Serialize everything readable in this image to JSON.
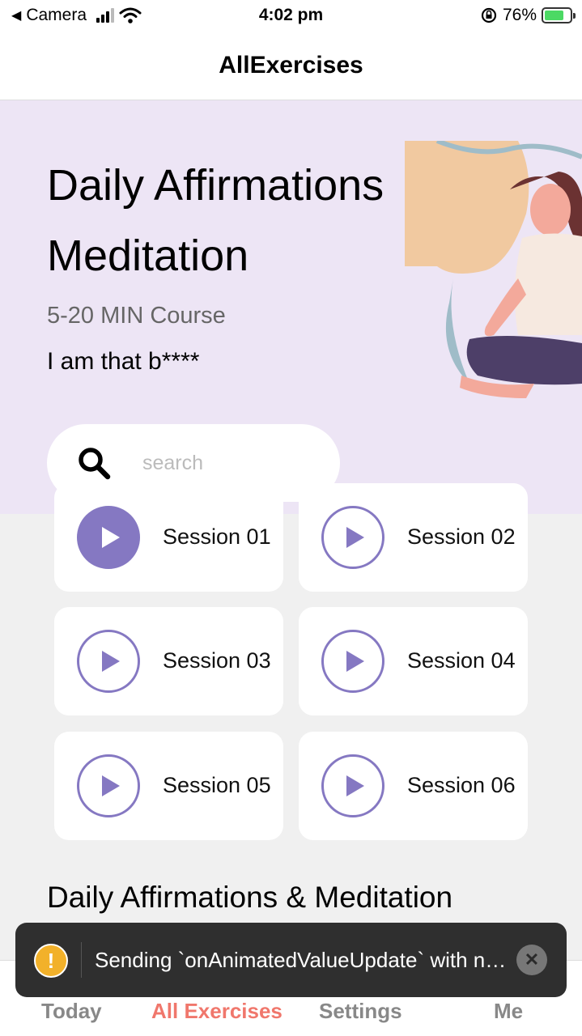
{
  "status_bar": {
    "back_app": "Camera",
    "time": "4:02 pm",
    "battery": "76%",
    "battery_level": 0.76
  },
  "header": {
    "title": "AllExercises"
  },
  "hero": {
    "title": "Daily Affirmations Meditation",
    "subtitle": "5-20 MIN Course",
    "tagline": "I am that b****"
  },
  "search": {
    "placeholder": "search",
    "value": ""
  },
  "sessions": [
    {
      "label": "Session 01",
      "active": true
    },
    {
      "label": "Session 02",
      "active": false
    },
    {
      "label": "Session 03",
      "active": false
    },
    {
      "label": "Session 04",
      "active": false
    },
    {
      "label": "Session 05",
      "active": false
    },
    {
      "label": "Session 06",
      "active": false
    }
  ],
  "section_title": "Daily Affirmations & Meditation",
  "toast": {
    "message": "Sending `onAnimatedValueUpdate` with no listeners registered."
  },
  "tabs": [
    {
      "label": "Today",
      "active": false
    },
    {
      "label": "All Exercises",
      "active": true
    },
    {
      "label": "Settings",
      "active": false
    },
    {
      "label": "Me",
      "active": false
    }
  ],
  "colors": {
    "accent": "#8578c2",
    "hero_bg": "#ede5f5",
    "active_tab": "#f0776c"
  },
  "icons": [
    "back-arrow-icon",
    "signal-icon",
    "wifi-icon",
    "orientation-lock-icon",
    "battery-icon",
    "search-icon",
    "play-icon",
    "warning-icon",
    "close-icon"
  ]
}
